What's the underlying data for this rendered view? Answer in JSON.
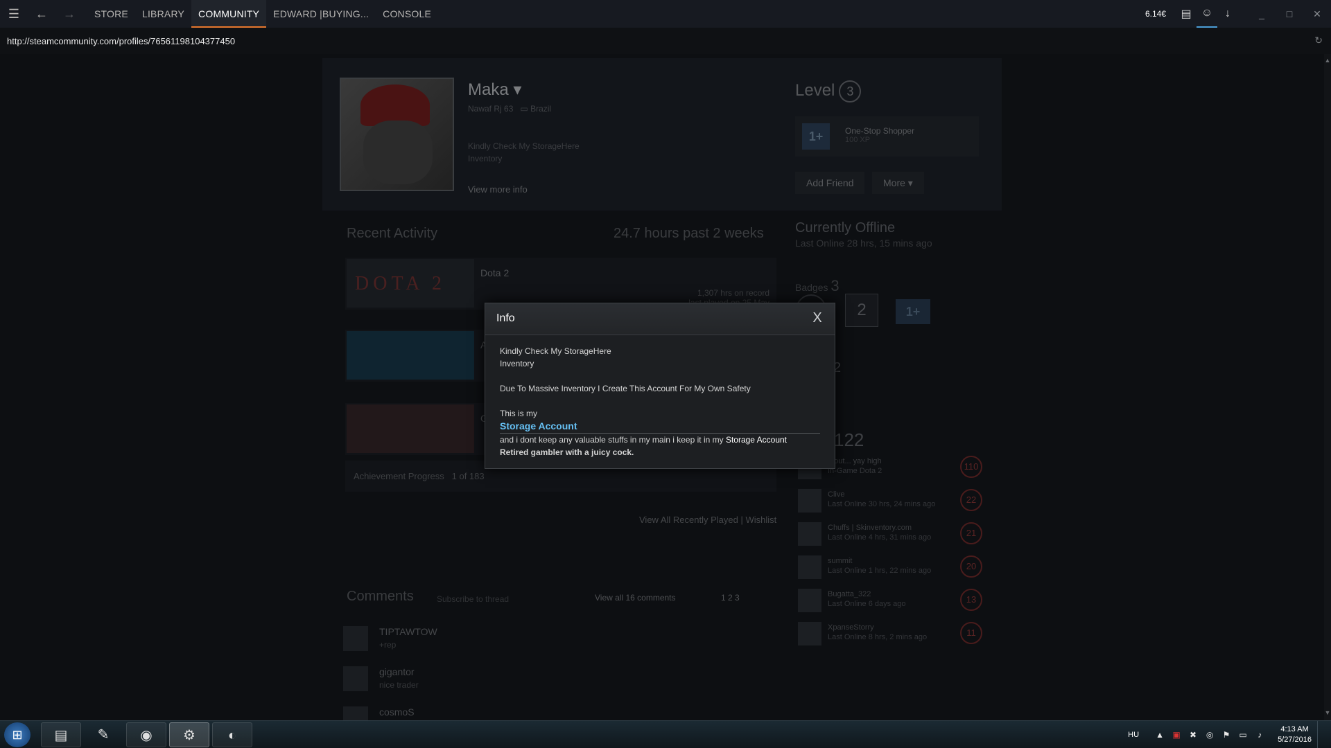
{
  "titlebar": {
    "nav": [
      "STORE",
      "LIBRARY",
      "COMMUNITY",
      "EDWARD |BUYING...",
      "CONSOLE"
    ],
    "active_index": 2,
    "wallet": "6.14€"
  },
  "url": "http://steamcommunity.com/profiles/76561198104377450",
  "profile": {
    "name": "Maka",
    "realname": "Nawaf Rj 63",
    "country": "Brazil",
    "summary_line1": "Kindly Check My StorageHere",
    "summary_line2": "Inventory",
    "view_more": "View more info",
    "level_label": "Level",
    "level": "3",
    "badge_icon": "1+",
    "badge_name": "One-Stop Shopper",
    "badge_xp": "100 XP",
    "add_friend": "Add Friend",
    "more": "More",
    "status": "Currently Offline",
    "last_online": "Last Online 28 hrs, 15 mins ago",
    "badges_label": "Badges",
    "badges_count": "3",
    "badge_2": "2",
    "badge_3": "1+",
    "groups_count": "2",
    "friends_count": "122"
  },
  "recent": {
    "title": "Recent Activity",
    "hours": "24.7 hours past 2 weeks",
    "games": [
      {
        "name": "Dota 2",
        "logo": "DOTA 2",
        "hrs1": "1,307 hrs on record",
        "hrs2": "last played on 25 May"
      },
      {
        "name": "A",
        "logo": "",
        "hrs1": "",
        "hrs2": ""
      },
      {
        "name": "G",
        "logo": "",
        "hrs1": "",
        "hrs2": ""
      }
    ],
    "ach_label": "Achievement Progress",
    "ach_value": "1 of 183",
    "view": "View",
    "all_played": "All Recently Played",
    "sep": "|",
    "wishlist": "Wishlist"
  },
  "comments": {
    "title": "Comments",
    "subscribe": "Subscribe to thread",
    "view_all": "View all 16 comments",
    "pages": "1 2 3",
    "items": [
      {
        "name": "TIPTAWTOW",
        "text": "+rep"
      },
      {
        "name": "gigantor",
        "text": "nice trader"
      },
      {
        "name": "cosmoS",
        "text": ""
      }
    ]
  },
  "friends": [
    {
      "name": "...out... yay high",
      "status": "In-Game Dota 2",
      "level": "110"
    },
    {
      "name": "Clive",
      "status": "Last Online 30 hrs, 24 mins ago",
      "level": "22"
    },
    {
      "name": "Chuffs | Skinventory.com",
      "status": "Last Online 4 hrs, 31 mins ago",
      "level": "21"
    },
    {
      "name": "summit",
      "status": "Last Online 1 hrs, 22 mins ago",
      "level": "20"
    },
    {
      "name": "Bugatta_322",
      "status": "Last Online 6 days ago",
      "level": "13"
    },
    {
      "name": "XpanseStorry",
      "status": "Last Online 8 hrs, 2 mins ago",
      "level": "11"
    }
  ],
  "modal": {
    "title": "Info",
    "close": "X",
    "line1": "Kindly Check My StorageHere",
    "line2": "Inventory",
    "line3": "Due To Massive Inventory I Create This Account For My Own Safety",
    "line4": "This is my",
    "link_big": "Storage Account",
    "line5_prefix": "and i dont keep any valuable stuffs in my main i keep it in my ",
    "line5_link": "Storage Account",
    "line6": "Retired gambler with a juicy cock."
  },
  "taskbar": {
    "lang": "HU",
    "time": "4:13 AM",
    "date": "5/27/2016"
  }
}
